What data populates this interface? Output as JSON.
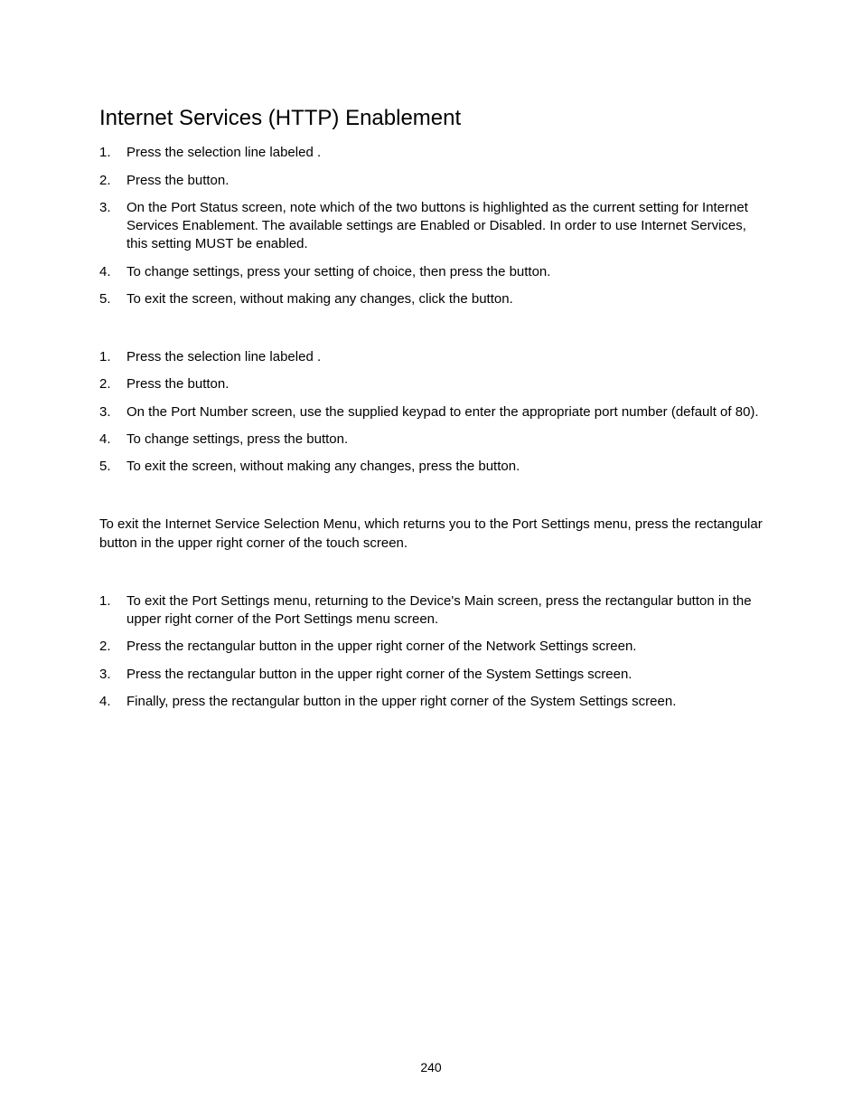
{
  "title": "Internet Services (HTTP) Enablement",
  "list1": {
    "i1": "Press the selection line labeled                              .",
    "i2": "Press the                               button.",
    "i3": "On the Port Status screen, note which of the two buttons is highlighted as the current setting for Internet Services Enablement.  The available settings are Enabled or Disabled.  In order to use Internet Services, this setting MUST be enabled.",
    "i4": "To change settings, press your setting of choice, then press the           button.",
    "i5": "To exit the screen, without making any changes, click the              button."
  },
  "list2": {
    "i1": "Press the selection line labeled                                 .",
    "i2": "Press the                               button.",
    "i3": "On the Port Number screen, use the supplied keypad to enter the appropriate port number (default of 80).",
    "i4": "To change settings, press the            button.",
    "i5": "To exit the screen, without making any changes, press the                 button."
  },
  "para1": "To exit the Internet Service Selection Menu, which returns you to the Port Settings menu, press the rectangular             button in the upper right corner of the touch screen.",
  "list3": {
    "i1": "To exit the Port Settings menu, returning to the Device's Main screen, press the rectangular             button in the upper right corner of the Port Settings menu screen.",
    "i2": "Press the rectangular             button in the upper right corner of the Network Settings screen.",
    "i3": "Press the rectangular             button in the upper right corner of the System Settings screen.",
    "i4": "Finally, press the rectangular           button in the upper right corner of the System Settings screen."
  },
  "pageNumber": "240"
}
